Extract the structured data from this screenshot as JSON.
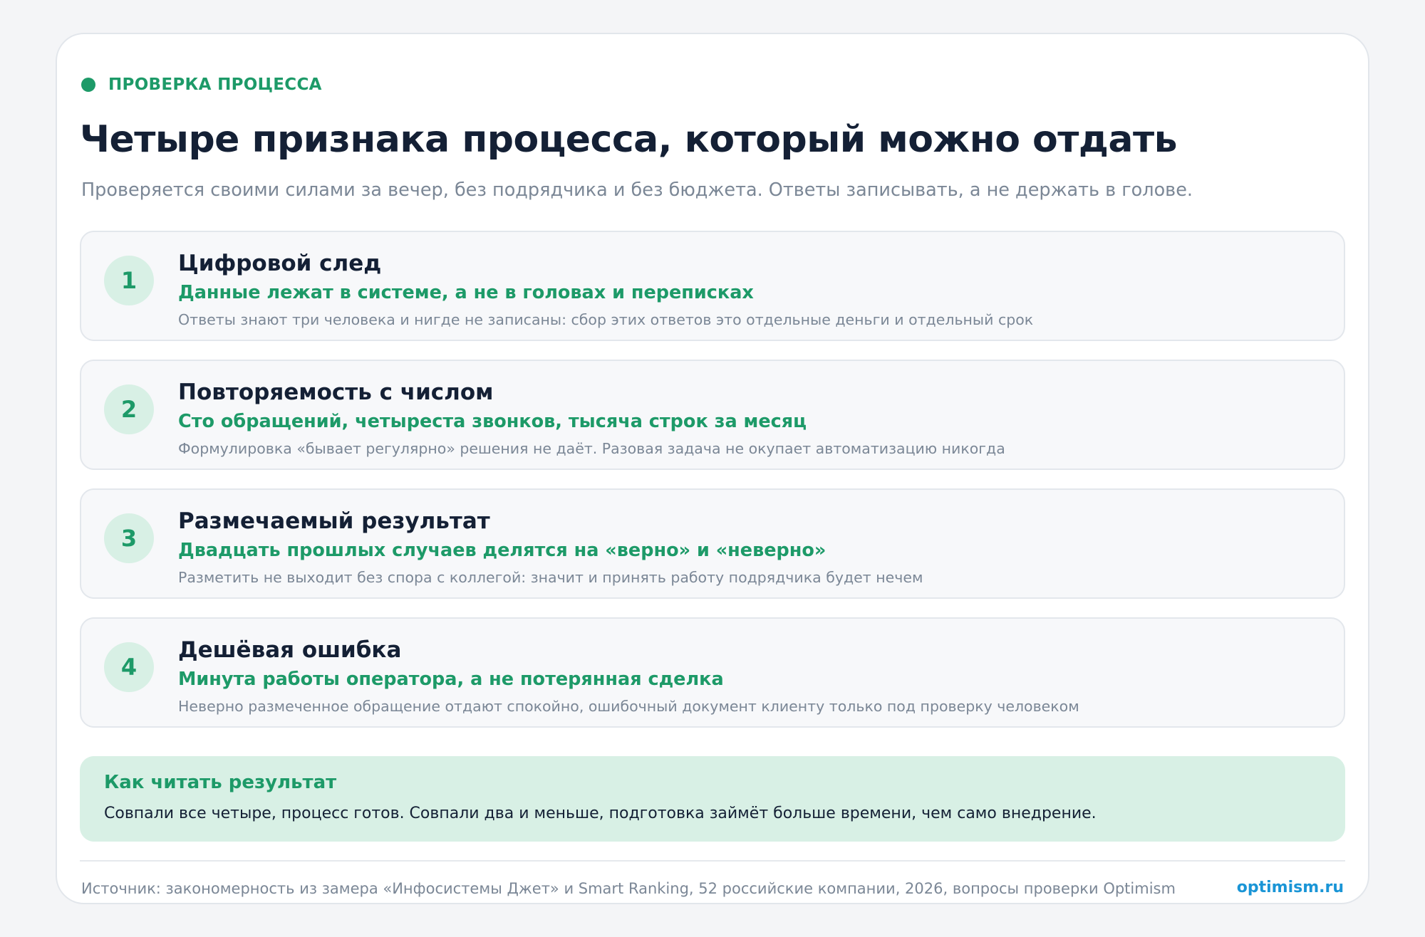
{
  "eyebrow": {
    "label": "ПРОВЕРКА ПРОЦЕССА"
  },
  "title": "Четыре признака процесса, который можно отдать",
  "subtitle": "Проверяется своими силами за вечер, без подрядчика и без бюджета. Ответы записывать, а не держать в голове.",
  "items": [
    {
      "number": "1",
      "title": "Цифровой след",
      "subtitle": "Данные лежат в системе, а не в головах и переписках",
      "description": "Ответы знают три человека и нигде не записаны: сбор этих ответов это отдельные деньги и отдельный срок"
    },
    {
      "number": "2",
      "title": "Повторяемость с числом",
      "subtitle": "Сто обращений, четыреста звонков, тысяча строк за месяц",
      "description": "Формулировка «бывает регулярно» решения не даёт. Разовая задача не окупает автоматизацию никогда"
    },
    {
      "number": "3",
      "title": "Размечаемый результат",
      "subtitle": "Двадцать прошлых случаев делятся на «верно» и «неверно»",
      "description": "Разметить не выходит без спора с коллегой: значит и принять работу подрядчика будет нечем"
    },
    {
      "number": "4",
      "title": "Дешёвая ошибка",
      "subtitle": "Минута работы оператора, а не потерянная сделка",
      "description": "Неверно размеченное обращение отдают спокойно, ошибочный документ клиенту только под проверку человеком"
    }
  ],
  "result": {
    "title": "Как читать результат",
    "text": "Совпали все четыре, процесс готов. Совпали два и меньше, подготовка займёт больше времени, чем само внедрение."
  },
  "footer": {
    "source": "Источник: закономерность из замера «Инфосистемы Джет» и Smart Ranking, 52 российские компании, 2026, вопросы проверки Optimism",
    "brand": "optimism.ru"
  },
  "colors": {
    "accent": "#1d9a68",
    "accent_light": "#d8f0e5",
    "heading": "#142035",
    "muted": "#7b8796",
    "brand": "#1a95d6"
  }
}
